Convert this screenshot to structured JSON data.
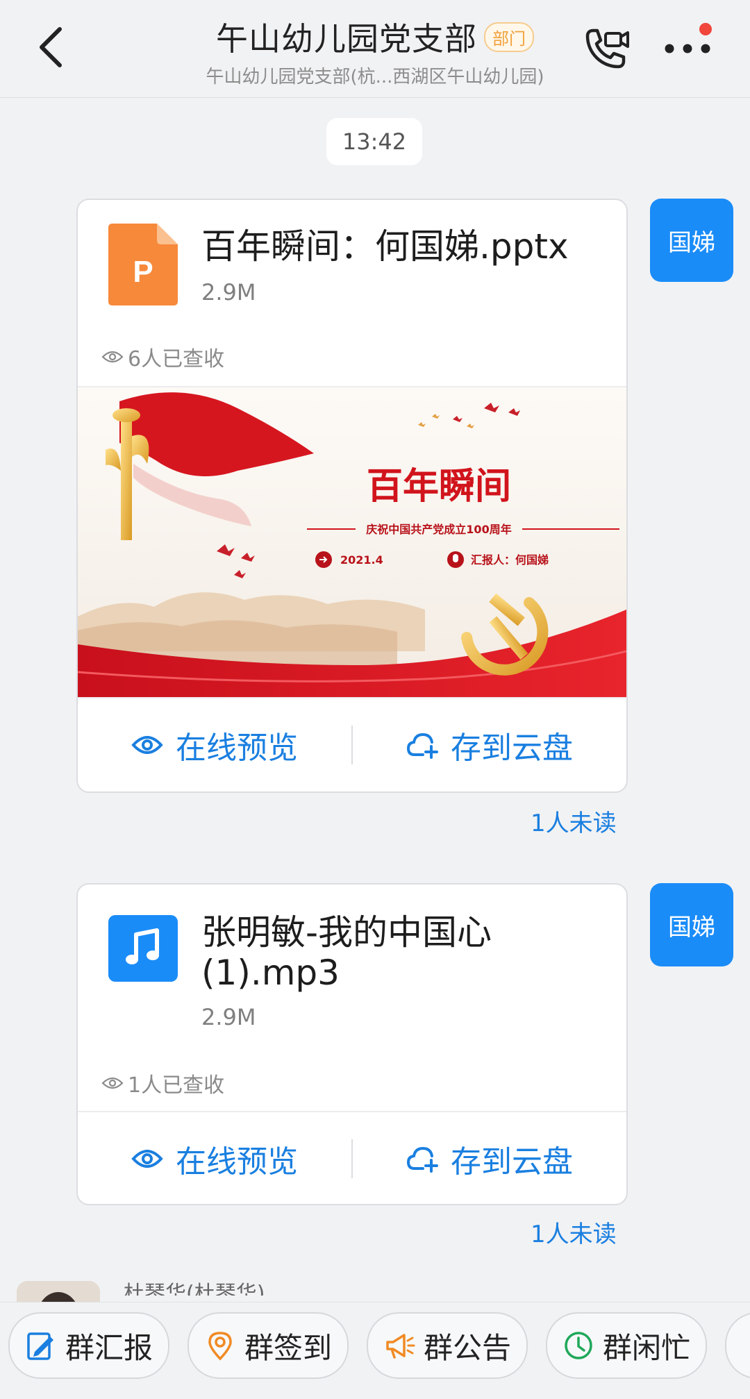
{
  "header": {
    "title": "午山幼儿园党支部",
    "badge": "部门",
    "subtitle": "午山幼儿园党支部(杭...西湖区午山幼儿园)"
  },
  "timestamp": "13:42",
  "messages": [
    {
      "sender_avatar": "国娣",
      "file_name": "百年瞬间：何国娣.pptx",
      "file_size": "2.9M",
      "viewed": "6人已查收",
      "preview": {
        "title": "百年瞬间",
        "subtitle": "庆祝中国共产党成立100周年",
        "date": "2021.4",
        "reporter": "汇报人：何国娣"
      },
      "actions": [
        "在线预览",
        "存到云盘"
      ],
      "unread": "1人未读"
    },
    {
      "sender_avatar": "国娣",
      "file_name": "张明敏-我的中国心(1).mp3",
      "file_size": "2.9M",
      "viewed": "1人已查收",
      "actions": [
        "在线预览",
        "存到云盘"
      ],
      "unread": "1人未读"
    }
  ],
  "next_sender": "杜琴华(杜琴华)",
  "bottom_actions": [
    {
      "label": "群汇报",
      "icon": "report-icon"
    },
    {
      "label": "群签到",
      "icon": "location-icon"
    },
    {
      "label": "群公告",
      "icon": "megaphone-icon"
    },
    {
      "label": "群闲忙",
      "icon": "clock-icon"
    }
  ],
  "colors": {
    "accent": "#1a7fe0",
    "avatar": "#1a8cf8",
    "ppt_orange": "#f6893a",
    "badge": "#f2a13a",
    "notification": "#f0463c"
  }
}
